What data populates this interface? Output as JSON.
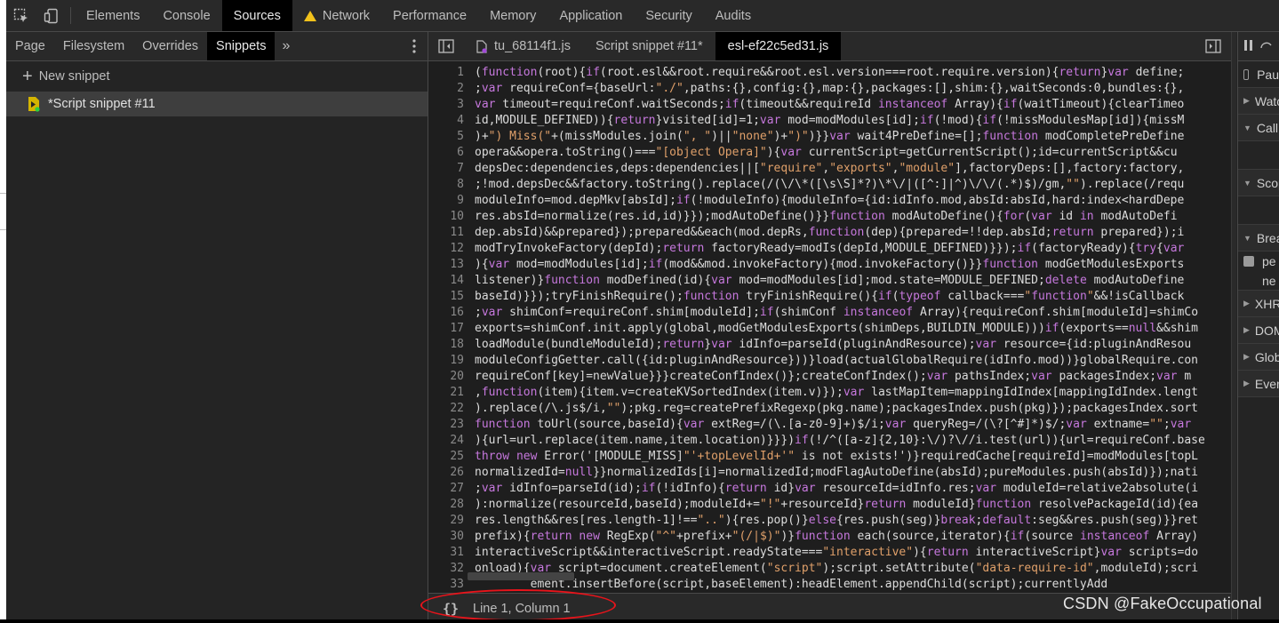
{
  "main_tabs": [
    {
      "label": "Elements"
    },
    {
      "label": "Console"
    },
    {
      "label": "Sources",
      "active": true
    },
    {
      "label": "Network",
      "warning": true
    },
    {
      "label": "Performance"
    },
    {
      "label": "Memory"
    },
    {
      "label": "Application"
    },
    {
      "label": "Security"
    },
    {
      "label": "Audits"
    }
  ],
  "navigator": {
    "tabs": [
      "Page",
      "Filesystem",
      "Overrides",
      "Snippets"
    ],
    "active_tab": "Snippets",
    "more": "»",
    "new_snippet_label": "New snippet",
    "snippets": [
      "*Script snippet #11"
    ]
  },
  "editor": {
    "tabs": [
      "tu_68114f1.js",
      "Script snippet #11*",
      "esl-ef22c5ed31.js"
    ],
    "active_tab": "esl-ef22c5ed31.js",
    "line_numbers": [
      "1",
      "2",
      "3",
      "4",
      "5",
      "6",
      "7",
      "8",
      "9",
      "10",
      "11",
      "12",
      "13",
      "14",
      "15",
      "16",
      "17",
      "18",
      "19",
      "20",
      "21",
      "22",
      "23",
      "24",
      "25",
      "26",
      "27",
      "28",
      "29",
      "30",
      "31",
      "32",
      "33"
    ],
    "lines": [
      "(function(root){if(root.esl&&root.require&&root.esl.version===root.require.version){return}var define;",
      ";var requireConf={baseUrl:\"./\",paths:{},config:{},map:{},packages:[],shim:{},waitSeconds:0,bundles:{},",
      "var timeout=requireConf.waitSeconds;if(timeout&&requireId instanceof Array){if(waitTimeout){clearTimeo",
      "id,MODULE_DEFINED)){return}visited[id]=1;var mod=modModules[id];if(!mod){if(!missModulesMap[id]){missM",
      ")+\") Miss(\"+(missModules.join(\", \")||\"none\")+\")\")}}var wait4PreDefine=[];function modCompletePreDefine",
      "opera&&opera.toString()===\"[object Opera]\"){var currentScript=getCurrentScript();id=currentScript&&cu",
      "depsDec:dependencies,deps:dependencies||[\"require\",\"exports\",\"module\"],factoryDeps:[],factory:factory,",
      ";!mod.depsDec&&factory.toString().replace(/(\\/\\*([\\s\\S]*?)\\*\\/|([^:]|^)\\/\\/(.*)$)/gm,\"\").replace(/requ",
      "moduleInfo=mod.depMkv[absId];if(!moduleInfo){moduleInfo={id:idInfo.mod,absId:absId,hard:index<hardDepe",
      "res.absId=normalize(res.id,id)}});modAutoDefine()}}function modAutoDefine(){for(var id in modAutoDefi",
      "dep.absId)&&prepared});prepared&&each(mod.depRs,function(dep){prepared=!!dep.absId;return prepared});i",
      "modTryInvokeFactory(depId);return factoryReady=modIs(depId,MODULE_DEFINED)}});if(factoryReady){try{var",
      "){var mod=modModules[id];if(mod&&mod.invokeFactory){mod.invokeFactory()}}function modGetModulesExports",
      "listener)}function modDefined(id){var mod=modModules[id];mod.state=MODULE_DEFINED;delete modAutoDefine",
      "baseId)}});tryFinishRequire();function tryFinishRequire(){if(typeof callback===\"function\"&&!isCallback",
      ";var shimConf=requireConf.shim[moduleId];if(shimConf instanceof Array){requireConf.shim[moduleId]=shimCo",
      "exports=shimConf.init.apply(global,modGetModulesExports(shimDeps,BUILDIN_MODULE)))if(exports==null&&shim",
      "loadModule(bundleModuleId);return}var idInfo=parseId(pluginAndResource);var resource={id:pluginAndResou",
      "moduleConfigGetter.call({id:pluginAndResource}))}load(actualGlobalRequire(idInfo.mod))}globalRequire.con",
      "requireConf[key]=newValue}}}createConfIndex()};createConfIndex();var pathsIndex;var packagesIndex;var m",
      ",function(item){item.v=createKVSortedIndex(item.v)});var lastMapItem=mappingIdIndex[mappingIdIndex.lengt",
      ").replace(/\\.js$/i,\"\");pkg.reg=createPrefixRegexp(pkg.name);packagesIndex.push(pkg)});packagesIndex.sort",
      "function toUrl(source,baseId){var extReg=/(\\.[a-z0-9]+)$/i;var queryReg=/(\\?[^#]*)$/;var extname=\"\";var",
      "){url=url.replace(item.name,item.location)}}})if(!/^([a-z]{2,10}:\\/)?\\//i.test(url)){url=requireConf.base",
      "throw new Error('[MODULE_MISS]\"'+topLevelId+'\" is not exists!')}requiredCache[requireId]=modModules[topL",
      "normalizedId=null}}normalizedIds[i]=normalizedId;modFlagAutoDefine(absId);pureModules.push(absId)});nati",
      ";var idInfo=parseId(id);if(!idInfo){return id}var resourceId=idInfo.res;var moduleId=relative2absolute(i",
      "):normalize(resourceId,baseId);moduleId+=\"!\"+resourceId}return moduleId}function resolvePackageId(id){ea",
      "res.length&&res[res.length-1]!==\"..\"){res.pop()}else{res.push(seg)}break;default:seg&&res.push(seg)}}ret",
      "prefix){return new RegExp(\"^\"+prefix+\"(/|$)\")}function each(source,iterator){if(source instanceof Array)",
      "interactiveScript&&interactiveScript.readyState===\"interactive\"){return interactiveScript}var scripts=do",
      "onload){var script=document.createElement(\"script\");script.setAttribute(\"data-require-id\",moduleId);scri",
      "        ement.insertBefore(script,baseElement):headElement.appendChild(script);currentlyAdd"
    ]
  },
  "status": {
    "pretty_print": "{}",
    "position": "Line 1, Column 1"
  },
  "debugger": {
    "pause_label": "Pau",
    "sections": [
      "Watc",
      "Call S",
      "Scop",
      "Break"
    ],
    "breakpoints": [
      "pe",
      "ne"
    ],
    "more_sections": [
      "XHR/",
      "DOM",
      "Globa",
      "Event"
    ]
  },
  "watermark": "CSDN @FakeOccupational",
  "colors": {
    "accent_annotation": "#e8141b",
    "warning": "#f2c21b",
    "snippet_icon": "#d4b400",
    "snippet_dot": "#2ecc40"
  }
}
